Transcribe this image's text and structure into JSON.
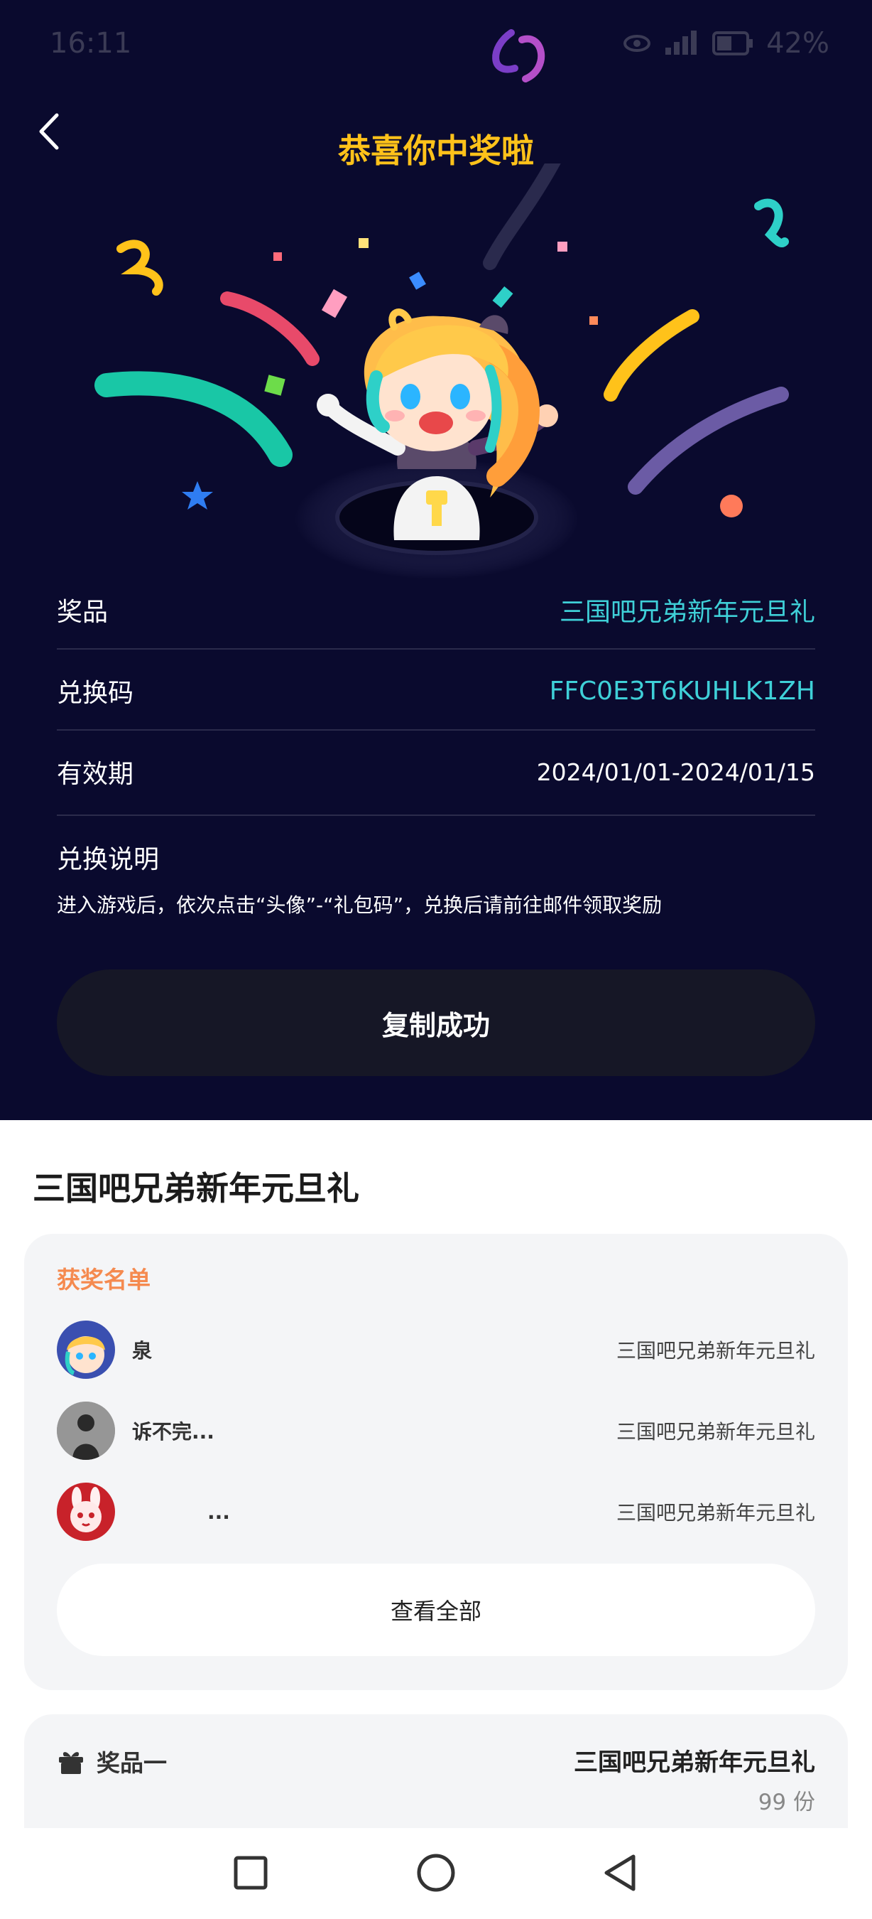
{
  "status_bar": {
    "time": "16:11",
    "battery": "42%"
  },
  "header": {
    "title": "恭喜你中奖啦"
  },
  "info": {
    "prize_label": "奖品",
    "prize_value": "三国吧兄弟新年元旦礼",
    "code_label": "兑换码",
    "code_value": "FFC0E3T6KUHLK1ZH",
    "validity_label": "有效期",
    "validity_value": "2024/01/01-2024/01/15",
    "exchange_label": "兑换说明",
    "exchange_desc": "进入游戏后，依次点击“头像”-“礼包码”，兑换后请前往邮件领取奖励"
  },
  "copy_button": "复制成功",
  "section_title": "三国吧兄弟新年元旦礼",
  "winners": {
    "title": "获奖名单",
    "rows": [
      {
        "name": "泉",
        "prize": "三国吧兄弟新年元旦礼"
      },
      {
        "name": "诉不完...",
        "prize": "三国吧兄弟新年元旦礼"
      },
      {
        "name": "...",
        "prize": "三国吧兄弟新年元旦礼"
      }
    ],
    "view_all": "查看全部"
  },
  "prize_card": {
    "label": "奖品一",
    "name": "三国吧兄弟新年元旦礼",
    "quantity": "99 份"
  },
  "colors": {
    "dark_bg": "#0a0a2e",
    "title_yellow": "#ffc21a",
    "accent_cyan": "#3fd0d8",
    "winner_orange": "#f58a4f"
  }
}
